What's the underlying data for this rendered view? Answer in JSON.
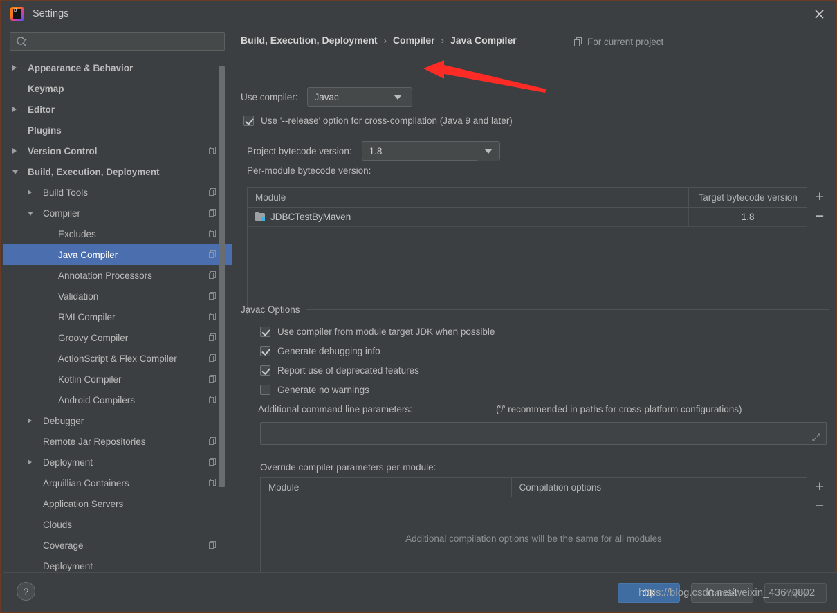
{
  "window": {
    "title": "Settings",
    "logo_icon": "intellij-idea-logo",
    "close_icon": "close-icon"
  },
  "sidebar": {
    "search": {
      "placeholder": "",
      "value": "",
      "icon": "search-icon"
    },
    "items": [
      {
        "label": "Appearance & Behavior",
        "indent": 0,
        "arrow": "collapsed",
        "bold": true,
        "copy": false,
        "selected": false
      },
      {
        "label": "Keymap",
        "indent": 0,
        "arrow": "none",
        "bold": true,
        "copy": false,
        "selected": false
      },
      {
        "label": "Editor",
        "indent": 0,
        "arrow": "collapsed",
        "bold": true,
        "copy": false,
        "selected": false
      },
      {
        "label": "Plugins",
        "indent": 0,
        "arrow": "none",
        "bold": true,
        "copy": false,
        "selected": false
      },
      {
        "label": "Version Control",
        "indent": 0,
        "arrow": "collapsed",
        "bold": true,
        "copy": true,
        "selected": false
      },
      {
        "label": "Build, Execution, Deployment",
        "indent": 0,
        "arrow": "expanded",
        "bold": true,
        "copy": false,
        "selected": false
      },
      {
        "label": "Build Tools",
        "indent": 1,
        "arrow": "collapsed",
        "bold": false,
        "copy": true,
        "selected": false
      },
      {
        "label": "Compiler",
        "indent": 1,
        "arrow": "expanded",
        "bold": false,
        "copy": true,
        "selected": false
      },
      {
        "label": "Excludes",
        "indent": 2,
        "arrow": "none",
        "bold": false,
        "copy": true,
        "selected": false
      },
      {
        "label": "Java Compiler",
        "indent": 2,
        "arrow": "none",
        "bold": false,
        "copy": true,
        "selected": true
      },
      {
        "label": "Annotation Processors",
        "indent": 2,
        "arrow": "none",
        "bold": false,
        "copy": true,
        "selected": false
      },
      {
        "label": "Validation",
        "indent": 2,
        "arrow": "none",
        "bold": false,
        "copy": true,
        "selected": false
      },
      {
        "label": "RMI Compiler",
        "indent": 2,
        "arrow": "none",
        "bold": false,
        "copy": true,
        "selected": false
      },
      {
        "label": "Groovy Compiler",
        "indent": 2,
        "arrow": "none",
        "bold": false,
        "copy": true,
        "selected": false
      },
      {
        "label": "ActionScript & Flex Compiler",
        "indent": 2,
        "arrow": "none",
        "bold": false,
        "copy": true,
        "selected": false
      },
      {
        "label": "Kotlin Compiler",
        "indent": 2,
        "arrow": "none",
        "bold": false,
        "copy": true,
        "selected": false
      },
      {
        "label": "Android Compilers",
        "indent": 2,
        "arrow": "none",
        "bold": false,
        "copy": true,
        "selected": false
      },
      {
        "label": "Debugger",
        "indent": 1,
        "arrow": "collapsed",
        "bold": false,
        "copy": false,
        "selected": false
      },
      {
        "label": "Remote Jar Repositories",
        "indent": 1,
        "arrow": "none",
        "bold": false,
        "copy": true,
        "selected": false
      },
      {
        "label": "Deployment",
        "indent": 1,
        "arrow": "collapsed",
        "bold": false,
        "copy": true,
        "selected": false
      },
      {
        "label": "Arquillian Containers",
        "indent": 1,
        "arrow": "none",
        "bold": false,
        "copy": true,
        "selected": false
      },
      {
        "label": "Application Servers",
        "indent": 1,
        "arrow": "none",
        "bold": false,
        "copy": false,
        "selected": false
      },
      {
        "label": "Clouds",
        "indent": 1,
        "arrow": "none",
        "bold": false,
        "copy": false,
        "selected": false
      },
      {
        "label": "Coverage",
        "indent": 1,
        "arrow": "none",
        "bold": false,
        "copy": true,
        "selected": false
      },
      {
        "label": "Deployment",
        "indent": 1,
        "arrow": "none",
        "bold": false,
        "copy": false,
        "selected": false
      }
    ]
  },
  "main": {
    "breadcrumb": [
      "Build, Execution, Deployment",
      "Compiler",
      "Java Compiler"
    ],
    "breadcrumb_separator": "›",
    "for_current_project": "For current project",
    "for_current_project_icon": "copy-scope-icon",
    "use_compiler": {
      "label": "Use compiler:",
      "value": "Javac",
      "caret_icon": "chevron-down-icon"
    },
    "release_option": {
      "label": "Use '--release' option for cross-compilation (Java 9 and later)",
      "checked": true
    },
    "project_bytecode": {
      "label": "Project bytecode version:",
      "value": "1.8",
      "caret_icon": "chevron-down-icon"
    },
    "per_module_table": {
      "title": "Per-module bytecode version:",
      "columns": [
        "Module",
        "Target bytecode version"
      ],
      "rows": [
        {
          "module": "JDBCTestByMaven",
          "module_icon": "module-icon",
          "target": "1.8"
        }
      ],
      "add_button": "+",
      "remove_button": "−"
    },
    "javac_options": {
      "group_title": "Javac Options",
      "checkboxes": [
        {
          "label": "Use compiler from module target JDK when possible",
          "checked": true
        },
        {
          "label": "Generate debugging info",
          "checked": true
        },
        {
          "label": "Report use of deprecated features",
          "checked": true
        },
        {
          "label": "Generate no warnings",
          "checked": false
        }
      ],
      "additional_params_label": "Additional command line parameters:",
      "additional_params_hint": "('/' recommended in paths for cross-platform configurations)",
      "additional_params_value": "",
      "expand_icon": "expand-icon"
    },
    "override_table": {
      "title": "Override compiler parameters per-module:",
      "columns": [
        "Module",
        "Compilation options"
      ],
      "empty_message": "Additional compilation options will be the same for all modules",
      "add_button": "+",
      "remove_button": "−"
    }
  },
  "footer": {
    "help_label": "?",
    "ok_label": "OK",
    "cancel_label": "Cancel",
    "apply_label": "Apply"
  },
  "annotations": {
    "arrow_color": "#fc2b26",
    "watermark": "https://blog.csdn.net/weixin_43670802"
  },
  "colors": {
    "background": "#3c3f41",
    "selection": "#4b6eaf",
    "accent_button": "#3f6ca1",
    "border": "#6b3a26",
    "module_blue": "#3fb2e0"
  }
}
